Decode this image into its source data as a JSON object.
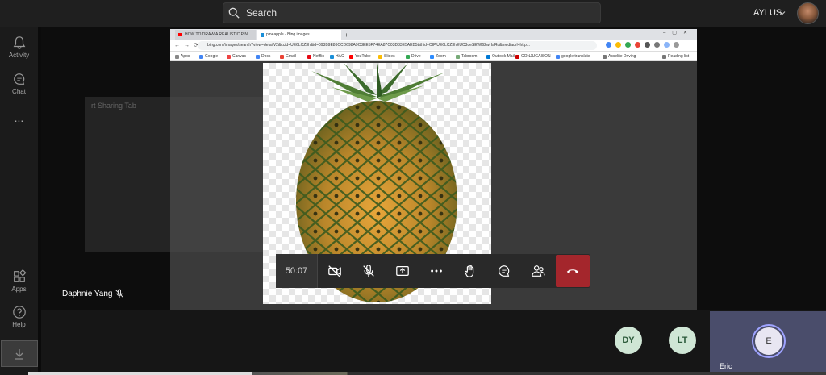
{
  "search": {
    "placeholder": "Search"
  },
  "user": {
    "name": "AYLUS"
  },
  "rail": {
    "activity": "Activity",
    "chat": "Chat",
    "more": "...",
    "apps": "Apps",
    "help": "Help"
  },
  "browser": {
    "tab1": "HOW TO DRAW A REALISTIC PIN...",
    "tab2": "pineapple - Bing images",
    "url": "bing.com/images/search?view=detailV2&ccid=UE6LCZ3h&id=093B9E86CCD698A9C3EE5F74EA87C03D83E5AEB5&thid=OIP.UE6LCZ3hEUC3ueSEWl62wHaRc&mediaurl=http...",
    "bookmarks": [
      "Apps",
      "Google",
      "Canvas",
      "Docs",
      "Gmail",
      "Netflix",
      "HAC",
      "YouTube",
      "Slides",
      "Drive",
      "Zoom",
      "Tabroom",
      "Outlook Mail",
      "CONJUGAISON",
      "google translate",
      "Accelite Driving",
      "Reading list"
    ]
  },
  "stage": {
    "ghost_text": "rt Sharing Tab",
    "presenter": "Daphnie Yang"
  },
  "controls": {
    "timer": "50:07"
  },
  "participants": [
    {
      "initials": "DY"
    },
    {
      "initials": "LT"
    }
  ],
  "eric": {
    "initial": "E",
    "name": "Eric"
  },
  "colors": {
    "hangup": "#a4262c",
    "avatar_bg": "#cfe6d5",
    "eric_tile": "#4a4d6b"
  }
}
